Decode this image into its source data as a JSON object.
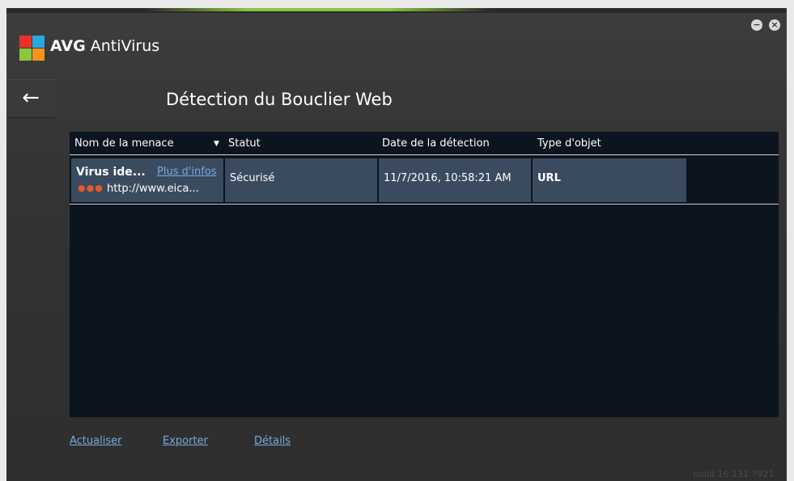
{
  "app": {
    "brand_strong": "AVG",
    "brand_rest": " AntiVirus",
    "minimize_glyph": "−",
    "close_glyph": "×"
  },
  "nav": {
    "back_glyph": "←"
  },
  "page": {
    "title": "Détection du Bouclier Web"
  },
  "table": {
    "headers": {
      "threat": "Nom de la menace",
      "sort_glyph": "▼",
      "status": "Statut",
      "date": "Date de la détection",
      "type": "Type d'objet"
    },
    "rows": [
      {
        "threat": "Virus ide...",
        "more_info": "Plus d'infos",
        "severity_dots": "●●●",
        "url": "http://www.eica...",
        "status": "Sécurisé",
        "date": "11/7/2016, 10:58:21 AM",
        "type": "URL"
      }
    ]
  },
  "actions": {
    "refresh": "Actualiser",
    "export": "Exporter",
    "details": "Détails"
  },
  "footer": {
    "build": "build 16.131.7921"
  },
  "colors": {
    "accent_green": "#8cc63f",
    "link_blue": "#7aa9e0",
    "row_bg": "#3a4b5f",
    "severity": "#e25a2b",
    "table_bg": "#0c1420"
  },
  "icons": [
    "avg-logo-icon",
    "back-arrow-icon",
    "minimize-icon",
    "close-icon",
    "sort-down-icon",
    "severity-dots-icon"
  ]
}
